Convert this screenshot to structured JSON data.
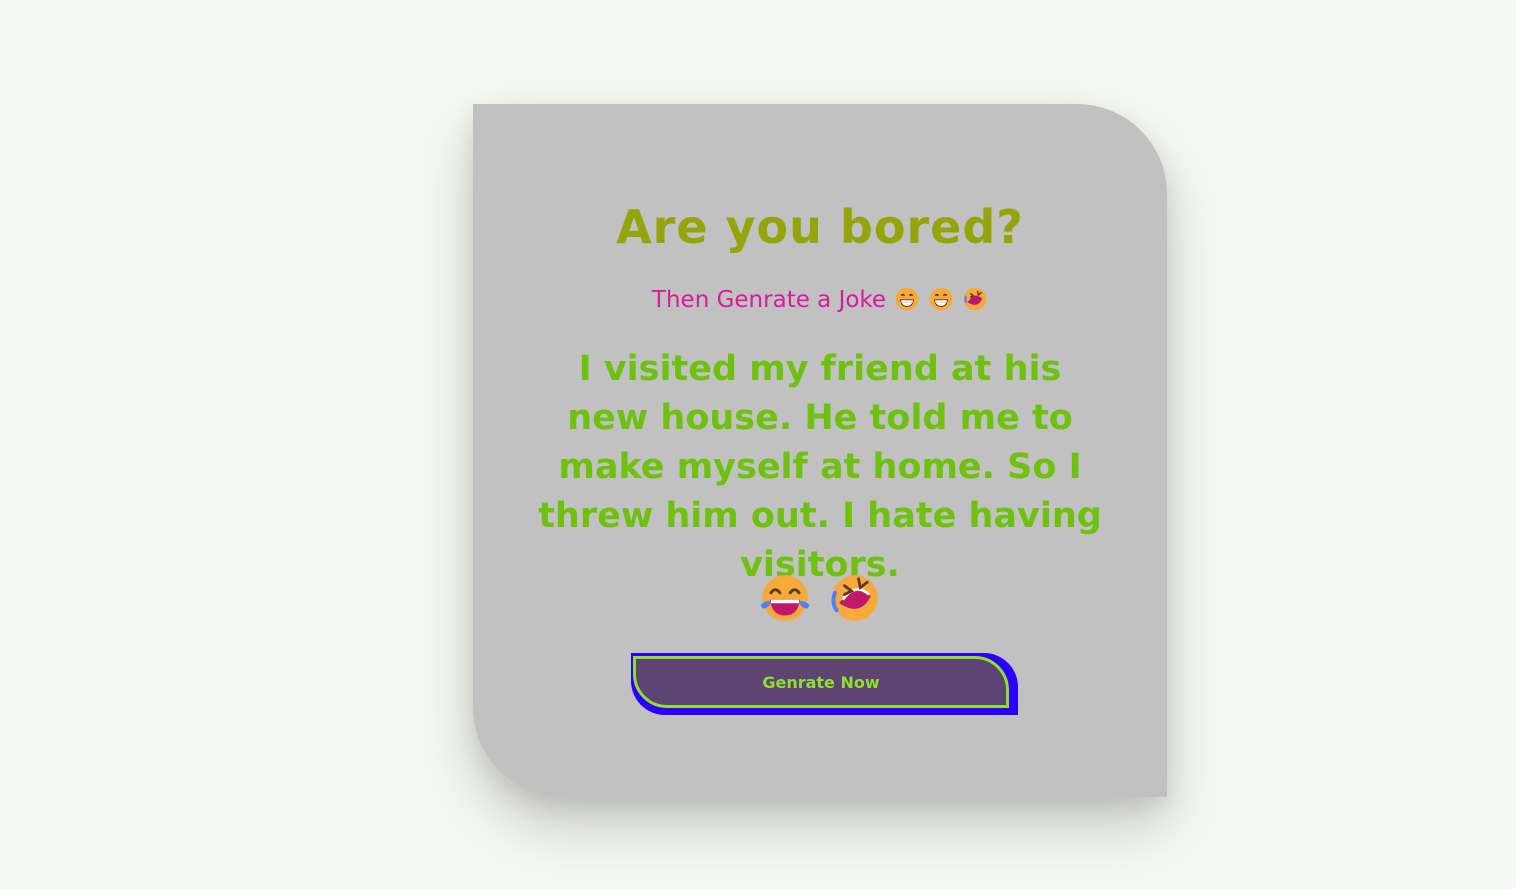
{
  "card": {
    "title": "Are you bored?",
    "subtitle": "Then Genrate a Joke",
    "subtitle_emojis": [
      "grinning-face-icon",
      "grinning-face-icon",
      "rolling-laughing-icon"
    ],
    "joke": "I visited my friend at his new house. He told me to make myself at home. So I threw him out. I hate having visitors.",
    "emojis": [
      "tears-of-joy-icon",
      "rolling-laughing-icon"
    ],
    "button_label": "Genrate Now"
  },
  "colors": {
    "background": "#f6f8f3",
    "card": "#c1c1c1",
    "title": "#94a50c",
    "subtitle": "#d81b9c",
    "joke": "#6fc10f",
    "button_bg": "#5d4473",
    "button_border": "#8ee02a",
    "button_glow": "#2b00ff"
  }
}
